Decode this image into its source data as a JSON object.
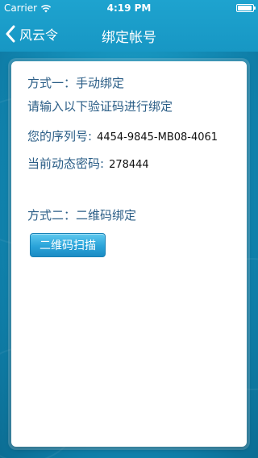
{
  "status_bar": {
    "carrier": "Carrier",
    "time": "4:19 PM"
  },
  "nav": {
    "back_label": "风云令",
    "title": "绑定帐号"
  },
  "method_one": {
    "title": "方式一：手动绑定",
    "instruction": "请输入以下验证码进行绑定",
    "serial_label": "您的序列号:",
    "serial_value": "4454-9845-MB08-4061",
    "code_label": "当前动态密码:",
    "code_value": "278444"
  },
  "method_two": {
    "title": "方式二：二维码绑定",
    "scan_button": "二维码扫描"
  },
  "colors": {
    "background": "#1591bb",
    "label_text": "#2a5d86",
    "button": "#2aa3d9"
  }
}
